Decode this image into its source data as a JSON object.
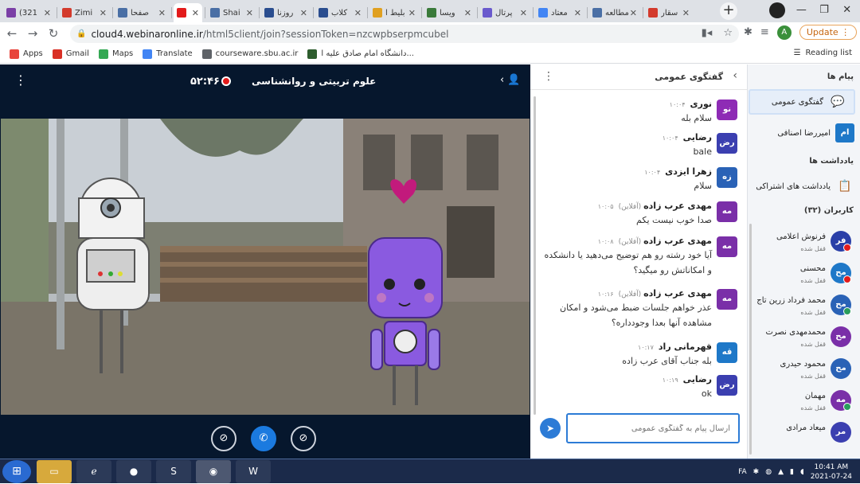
{
  "browser": {
    "tabs": [
      {
        "title": "(321",
        "icon_color": "#7b3fa6",
        "close": "✕"
      },
      {
        "title": "Zimi",
        "icon_color": "#d33a2c",
        "close": "✕"
      },
      {
        "title": "صفحا",
        "icon_color": "#4a6fa5",
        "close": "✕"
      },
      {
        "title": "",
        "icon_color": "#e31b1b",
        "close": "✕"
      },
      {
        "title": "Shai",
        "icon_color": "#4a6fa5",
        "close": "✕"
      },
      {
        "title": "روزنا",
        "icon_color": "#2a4d8f",
        "close": "✕"
      },
      {
        "title": "کلاب",
        "icon_color": "#2a4d8f",
        "close": "✕"
      },
      {
        "title": "بلیط ا",
        "icon_color": "#e0a020",
        "close": "✕"
      },
      {
        "title": "ویسا",
        "icon_color": "#3a7a3a",
        "close": "✕"
      },
      {
        "title": "پرتال",
        "icon_color": "#6a5acd",
        "close": "✕"
      },
      {
        "title": "معتاد",
        "icon_color": "#4285f4",
        "close": "✕"
      },
      {
        "title": "مطالعه",
        "icon_color": "#4a6fa5",
        "close": "✕"
      },
      {
        "title": "سقار",
        "icon_color": "#d33a2c",
        "close": "✕"
      }
    ],
    "new_tab": "+",
    "window_controls": [
      "—",
      "❐",
      "✕"
    ],
    "url_host": "cloud4.webinaronline.ir",
    "url_path": "/html5client/join?sessionToken=nzcwpbserpmcubel",
    "profile_initial": "A",
    "update_label": "Update",
    "bookmarks": [
      {
        "label": "Apps",
        "icon_color": "#e8453c"
      },
      {
        "label": "Gmail",
        "icon_color": "#d93025"
      },
      {
        "label": "Maps",
        "icon_color": "#34a853"
      },
      {
        "label": "Translate",
        "icon_color": "#4285f4"
      },
      {
        "label": "courseware.sbu.ac.ir",
        "icon_color": "#5f6368"
      },
      {
        "label": "دانشگاه امام صادق علیه ا...",
        "icon_color": "#2e5d2e"
      }
    ],
    "reading_list": "Reading list"
  },
  "meeting": {
    "timer": "۵۲:۴۶",
    "title": "علوم تربیتی و روانشناسی"
  },
  "chat": {
    "title": "گفتگوی عمومی",
    "input_placeholder": "ارسال پیام به گفتگوی عمومی",
    "messages": [
      {
        "initials": "نو",
        "color": "#8e2bb5",
        "name": "نوری",
        "status": "",
        "time": "۱۰:۰۴",
        "text": "سلام بله"
      },
      {
        "initials": "رض",
        "color": "#3b3fb0",
        "name": "رضایی",
        "status": "",
        "time": "۱۰:۰۴",
        "text": "bale"
      },
      {
        "initials": "زه",
        "color": "#2a62b6",
        "name": "زهرا ایزدی",
        "status": "",
        "time": "۱۰:۰۴",
        "text": "سلام"
      },
      {
        "initials": "مه",
        "color": "#7a2fa8",
        "name": "مهدی عرب زاده",
        "status": "(آفلاین)",
        "time": "۱۰:۰۵",
        "text": "صدا خوب نیست یکم"
      },
      {
        "initials": "مه",
        "color": "#7a2fa8",
        "name": "مهدی عرب زاده",
        "status": "(آفلاین)",
        "time": "۱۰:۰۸",
        "text": "آیا خود رشته رو هم توضیح می‌دهید یا دانشکده و امکاناتش رو میگید؟"
      },
      {
        "initials": "مه",
        "color": "#7a2fa8",
        "name": "مهدی عرب زاده",
        "status": "(آفلاین)",
        "time": "۱۰:۱۶",
        "text": "عذر خواهم جلسات ضبط می‌شود و امکان مشاهده آنها بعدا وجودداره؟"
      },
      {
        "initials": "قه",
        "color": "#1e78c8",
        "name": "قهرمانی راد",
        "status": "",
        "time": "۱۰:۱۷",
        "text": "بله جناب آقای عرب زاده"
      },
      {
        "initials": "رض",
        "color": "#3b3fb0",
        "name": "رضایی",
        "status": "",
        "time": "۱۰:۱۹",
        "text": "ok"
      }
    ]
  },
  "sidebar": {
    "messages_heading": "پیام ها",
    "public_chat_label": "گفتگوی عمومی",
    "private_initials": "ام",
    "private_name": "امیررضا اصنافی",
    "notes_heading": "یادداشت ها",
    "shared_notes_label": "یادداشت های اشتراکی",
    "users_heading": "کاربران (۳۲)",
    "users": [
      {
        "initials": "فر",
        "name": "فرنوش اعلامی",
        "status": "قفل شده",
        "color": "#2a3fa8",
        "badge": "#e31b1b"
      },
      {
        "initials": "مح",
        "name": "محسنی",
        "status": "قفل شده",
        "color": "#1e78c8",
        "badge": "#e31b1b"
      },
      {
        "initials": "مح",
        "name": "محمد فرداد زرین تاج",
        "status": "قفل شده",
        "color": "#2a62b6",
        "badge": "#2a9d5c"
      },
      {
        "initials": "مح",
        "name": "محمدمهدی نصرت",
        "status": "قفل شده",
        "color": "#7a2fa8",
        "badge": ""
      },
      {
        "initials": "مح",
        "name": "محمود حیدری",
        "status": "قفل شده",
        "color": "#2a62b6",
        "badge": ""
      },
      {
        "initials": "مه",
        "name": "مهمان",
        "status": "قفل شده",
        "color": "#7a2fa8",
        "badge": "#2a9d5c"
      },
      {
        "initials": "مر",
        "name": "میعاد مرادی",
        "status": "",
        "color": "#3b3fb0",
        "badge": ""
      }
    ]
  },
  "taskbar": {
    "lang": "FA",
    "time": "10:41 AM",
    "date": "2021-07-24"
  }
}
